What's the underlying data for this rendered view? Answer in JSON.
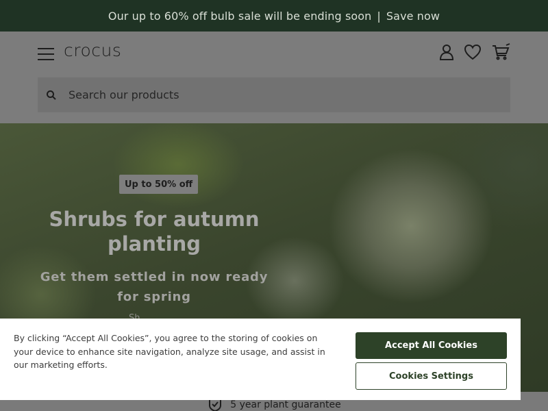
{
  "promo": {
    "message": "Our up to 60% off bulb sale will be ending soon",
    "separator": "|",
    "cta": "Save now"
  },
  "header": {
    "logo": "crocus",
    "icons": [
      "menu-icon",
      "account-icon",
      "heart-icon",
      "basket-icon"
    ]
  },
  "search": {
    "placeholder": "Search our products",
    "icon": "search-icon"
  },
  "hero": {
    "badge": "Up to 50% off",
    "title": "Shrubs for autumn planting",
    "subtitle": "Get them settled in now ready for spring",
    "link": "Sh..."
  },
  "guarantee": {
    "text": "5 year plant guarantee",
    "icon": "shield-check-icon"
  },
  "cookie": {
    "text": "By clicking “Accept All Cookies”, you agree to the storing of cookies on your device to enhance site navigation, analyze site usage, and assist in our marketing efforts.",
    "accept_label": "Accept All Cookies",
    "settings_label": "Cookies Settings"
  },
  "colors": {
    "brand_dark_green": "#1f3324",
    "button_green": "#2d4228",
    "overlay_grey": "#7c7c7c"
  }
}
